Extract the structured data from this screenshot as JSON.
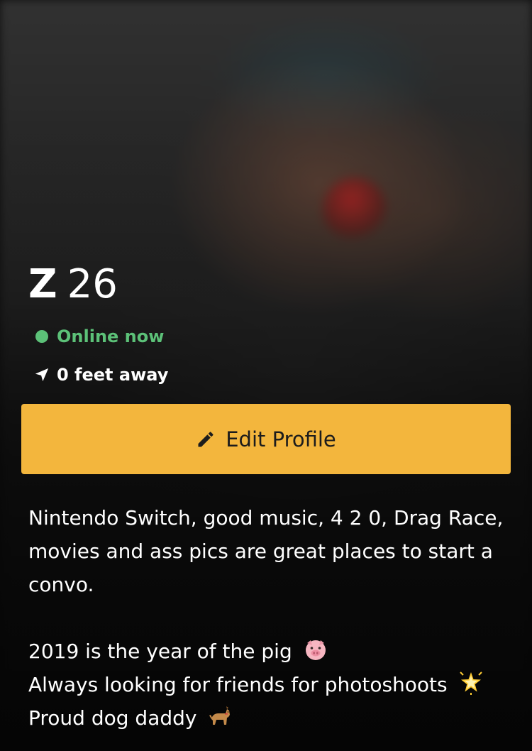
{
  "profile": {
    "name": "Z",
    "age": "26",
    "status": "Online now",
    "distance": "0 feet away"
  },
  "actions": {
    "edit_label": "Edit Profile"
  },
  "bio": {
    "paragraph1": "Nintendo Switch, good music, 4 2 0, Drag Race, movies and ass pics are great places to start a convo.",
    "line1": "2019 is the year of the pig",
    "line2": "Always looking for friends for photoshoots",
    "line3": "Proud dog daddy"
  },
  "icons": {
    "status": "online-dot-icon",
    "distance": "location-arrow-icon",
    "edit": "pencil-icon",
    "line1": "pig-face-emoji-icon",
    "line2": "glowing-star-emoji-icon",
    "line3": "dog-emoji-icon"
  },
  "colors": {
    "online": "#5cc178",
    "button": "#f3b63d",
    "button_text": "#1c1c1c",
    "text": "#ffffff"
  }
}
